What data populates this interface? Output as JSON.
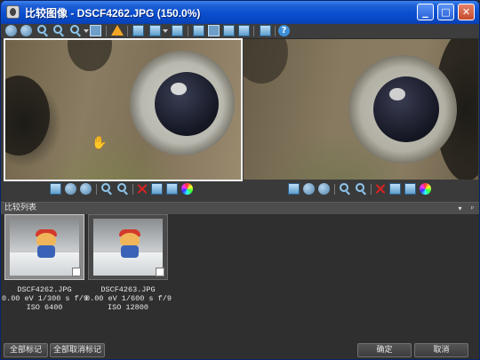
{
  "window": {
    "title": "比较图像 - DSCF4262.JPG (150.0%)",
    "minimize_symbol": "_",
    "maximize_symbol": "□",
    "close_symbol": "✕"
  },
  "toolbar": {
    "icons": [
      "back-icon",
      "forward-icon",
      "zoom-in-icon",
      "zoom-out-icon",
      "zoom-menu-icon",
      "zoom-fit-icon",
      "warning-icon",
      "view-single-icon",
      "view-grid-icon",
      "view-rotate-icon",
      "view-list-icon",
      "compare-side-icon",
      "compare-layout-icon",
      "compare-stack-icon",
      "info-panel-icon",
      "help-icon"
    ],
    "help_symbol": "?"
  },
  "panes": [
    {
      "file": "DSCF4262.JPG",
      "selected": true
    },
    {
      "file": "DSCF4263.JPG",
      "selected": false
    }
  ],
  "pane_toolbar_icons": [
    "save-icon",
    "prev-icon",
    "next-icon",
    "zoom-in-icon",
    "zoom-out-icon",
    "delete-icon",
    "grid-icon",
    "clipboard-icon",
    "color-icon"
  ],
  "compare_list": {
    "title": "比较列表",
    "pin_symbol": "▾",
    "close_symbol": "ᵖ",
    "items": [
      {
        "line1": "DSCF4262.JPG",
        "line2": "0.00 eV 1/300 s f/9",
        "line3": "ISO 6400",
        "selected": true
      },
      {
        "line1": "DSCF4263.JPG",
        "line2": "0.00 eV 1/600 s f/9",
        "line3": "ISO 12800",
        "selected": false
      }
    ]
  },
  "buttons": {
    "mark_all": "全部标记",
    "unmark_all": "全部取消标记",
    "ok": "确定",
    "cancel": "取消"
  }
}
